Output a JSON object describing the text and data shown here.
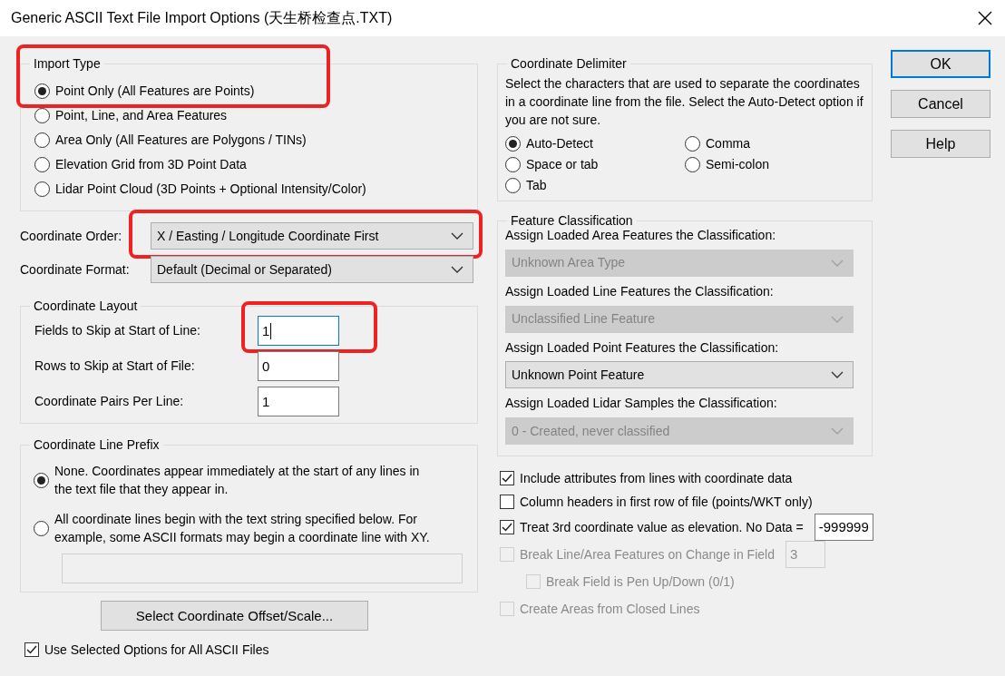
{
  "window": {
    "title": "Generic ASCII Text File Import Options (天生桥检查点.TXT)"
  },
  "import_type": {
    "label": "Import Type",
    "highlighted": true,
    "options": [
      {
        "label": "Point Only (All Features are Points)",
        "selected": true
      },
      {
        "label": "Point, Line, and Area Features",
        "selected": false
      },
      {
        "label": "Area Only (All Features are Polygons / TINs)",
        "selected": false
      },
      {
        "label": "Elevation Grid from 3D Point Data",
        "selected": false
      },
      {
        "label": "Lidar Point Cloud (3D Points + Optional Intensity/Color)",
        "selected": false
      }
    ]
  },
  "coordinate_order": {
    "label": "Coordinate Order:",
    "value": "X / Easting / Longitude Coordinate First",
    "highlighted": true
  },
  "coordinate_format": {
    "label": "Coordinate Format:",
    "value": "Default (Decimal or Separated)"
  },
  "coordinate_layout": {
    "label": "Coordinate Layout",
    "fields": [
      {
        "label": "Fields to Skip at Start of Line:",
        "value": "1",
        "focused": true,
        "highlighted": true
      },
      {
        "label": "Rows to Skip at Start of File:",
        "value": "0",
        "focused": false
      },
      {
        "label": "Coordinate Pairs Per Line:",
        "value": "1",
        "focused": false
      }
    ]
  },
  "coordinate_line_prefix": {
    "label": "Coordinate Line Prefix",
    "options": [
      {
        "label": "None. Coordinates appear immediately at the start of any lines in the text file that they appear in.",
        "selected": true
      },
      {
        "label": "All coordinate lines begin with the text string specified below. For example, some ASCII formats may begin a coordinate line with XY.",
        "selected": false
      }
    ],
    "prefix_field": {
      "disabled": true
    }
  },
  "offset_button": {
    "label": "Select Coordinate Offset/Scale..."
  },
  "use_for_all": {
    "label": "Use Selected Options for All ASCII Files",
    "checked": true
  },
  "coordinate_delimiter": {
    "label": "Coordinate Delimiter",
    "description": "Select the characters that are used to separate the coordinates in a coordinate line from the file. Select the Auto-Detect option if you are not sure.",
    "options": [
      {
        "label": "Auto-Detect",
        "selected": true
      },
      {
        "label": "Comma",
        "selected": false
      },
      {
        "label": "Space or tab",
        "selected": false
      },
      {
        "label": "Semi-colon",
        "selected": false
      },
      {
        "label": "Tab",
        "selected": false
      }
    ]
  },
  "feature_classification": {
    "label": "Feature Classification",
    "items": [
      {
        "label": "Assign Loaded Area Features the Classification:",
        "value": "Unknown Area Type",
        "disabled": true
      },
      {
        "label": "Assign Loaded Line Features the Classification:",
        "value": "Unclassified Line Feature",
        "disabled": true
      },
      {
        "label": "Assign Loaded Point Features the Classification:",
        "value": "Unknown Point Feature",
        "disabled": false
      },
      {
        "label": "Assign Loaded Lidar Samples the Classification:",
        "value": "0 - Created, never classified",
        "disabled": true
      }
    ]
  },
  "options": [
    {
      "label": "Include attributes from lines with coordinate data",
      "checked": true,
      "disabled": false
    },
    {
      "label": "Column headers in first row of file (points/WKT only)",
      "checked": false,
      "disabled": false
    },
    {
      "label": "Treat 3rd coordinate value as elevation. No Data =",
      "checked": true,
      "disabled": false,
      "field": {
        "value": "-999999",
        "disabled": false
      }
    },
    {
      "label": "Break Line/Area Features on Change in Field",
      "checked": false,
      "disabled": true,
      "field": {
        "value": "3",
        "disabled": true
      },
      "children": [
        {
          "label": "Break Field is Pen Up/Down (0/1)",
          "checked": false,
          "disabled": true
        }
      ]
    },
    {
      "label": "Create Areas from Closed Lines",
      "checked": false,
      "disabled": true
    }
  ],
  "buttons": [
    {
      "label": "OK",
      "default": true
    },
    {
      "label": "Cancel",
      "default": false
    },
    {
      "label": "Help",
      "default": false
    }
  ]
}
